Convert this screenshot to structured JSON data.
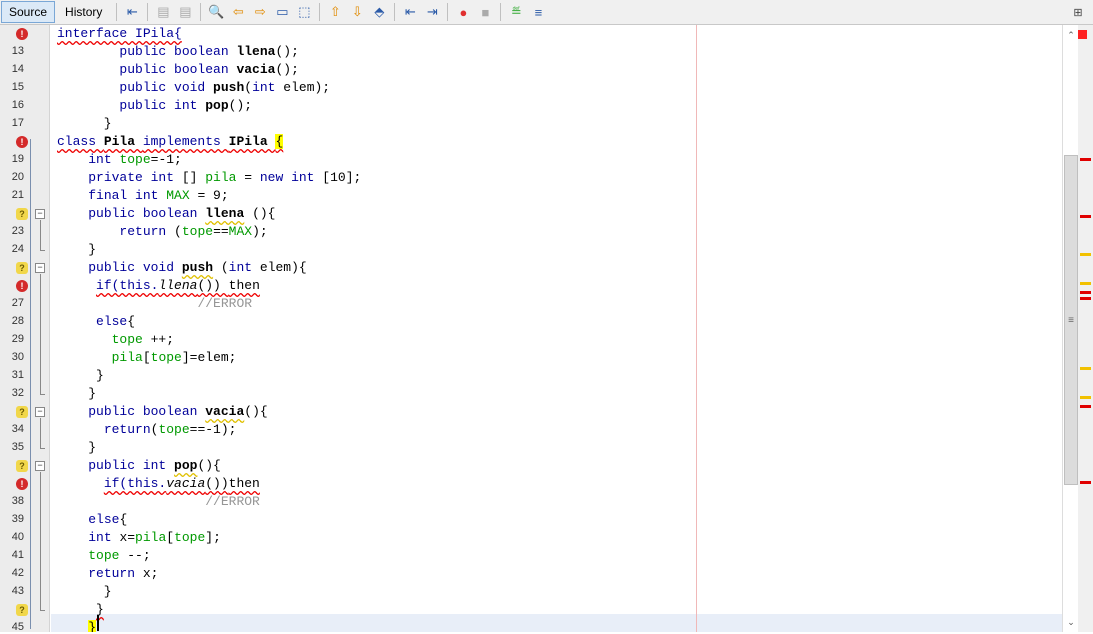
{
  "toolbar": {
    "tabs": [
      {
        "label": "Source",
        "active": true
      },
      {
        "label": "History",
        "active": false
      }
    ],
    "buttons": [
      "last-edit-icon",
      "back-icon",
      "forward-icon",
      "find-icon",
      "find-previous-icon",
      "find-next-icon",
      "toggle-highlight-icon",
      "rect-select-icon",
      "previous-bookmark-icon",
      "next-bookmark-icon",
      "toggle-bookmark-icon",
      "shift-left-icon",
      "shift-right-icon",
      "record-macro-icon",
      "stop-macro-icon",
      "comment-icon",
      "uncomment-icon"
    ]
  },
  "colors": {
    "error": "#e00000",
    "warning": "#f2c100",
    "keyword": "#000099",
    "field": "#009900",
    "comment": "#969696"
  },
  "lines": [
    {
      "n": "",
      "icon": "error",
      "t": [
        [
          "interface IPila{",
          "kw err"
        ]
      ]
    },
    {
      "n": "13",
      "t": [
        [
          "        ",
          ""
        ],
        [
          "public boolean ",
          "kw"
        ],
        [
          "llena",
          "mth"
        ],
        [
          "();",
          ""
        ]
      ]
    },
    {
      "n": "14",
      "t": [
        [
          "        ",
          ""
        ],
        [
          "public boolean ",
          "kw"
        ],
        [
          "vacia",
          "mth"
        ],
        [
          "();",
          ""
        ]
      ]
    },
    {
      "n": "15",
      "t": [
        [
          "        ",
          ""
        ],
        [
          "public void ",
          "kw"
        ],
        [
          "push",
          "mth"
        ],
        [
          "(",
          ""
        ],
        [
          "int ",
          "kw"
        ],
        [
          "elem);",
          ""
        ]
      ]
    },
    {
      "n": "16",
      "t": [
        [
          "        ",
          ""
        ],
        [
          "public int ",
          "kw"
        ],
        [
          "pop",
          "mth"
        ],
        [
          "();",
          ""
        ]
      ]
    },
    {
      "n": "17",
      "t": [
        [
          "      }",
          ""
        ]
      ]
    },
    {
      "n": "",
      "icon": "error",
      "t": [
        [
          "class ",
          "kw err"
        ],
        [
          "Pila ",
          "mth err"
        ],
        [
          "implements ",
          "kw err"
        ],
        [
          "IPila ",
          "mth err"
        ],
        [
          "{",
          "hl err"
        ]
      ]
    },
    {
      "n": "19",
      "t": [
        [
          "    ",
          ""
        ],
        [
          "int ",
          "kw"
        ],
        [
          "tope",
          "fld"
        ],
        [
          "=-1;",
          ""
        ]
      ]
    },
    {
      "n": "20",
      "t": [
        [
          "    ",
          ""
        ],
        [
          "private int ",
          "kw"
        ],
        [
          "[] ",
          ""
        ],
        [
          "pila",
          "fld"
        ],
        [
          " = ",
          ""
        ],
        [
          "new int ",
          "kw"
        ],
        [
          "[10];",
          ""
        ]
      ]
    },
    {
      "n": "21",
      "t": [
        [
          "    ",
          ""
        ],
        [
          "final int ",
          "kw"
        ],
        [
          "MAX",
          "fld"
        ],
        [
          " = 9;",
          ""
        ]
      ]
    },
    {
      "n": "",
      "icon": "warning",
      "fold": true,
      "t": [
        [
          "    ",
          ""
        ],
        [
          "public boolean ",
          "kw"
        ],
        [
          "llena",
          "mth wrn"
        ],
        [
          " (){",
          ""
        ]
      ]
    },
    {
      "n": "23",
      "t": [
        [
          "        ",
          ""
        ],
        [
          "return ",
          "kw"
        ],
        [
          "(",
          ""
        ],
        [
          "tope",
          "fld"
        ],
        [
          "==",
          ""
        ],
        [
          "MAX",
          "fld"
        ],
        [
          ");",
          ""
        ]
      ]
    },
    {
      "n": "24",
      "t": [
        [
          "    }",
          ""
        ]
      ]
    },
    {
      "n": "",
      "icon": "warning",
      "fold": true,
      "t": [
        [
          "    ",
          ""
        ],
        [
          "public void ",
          "kw"
        ],
        [
          "push",
          "mth wrn"
        ],
        [
          " (",
          ""
        ],
        [
          "int ",
          "kw"
        ],
        [
          "elem){",
          ""
        ]
      ]
    },
    {
      "n": "",
      "icon": "error",
      "t": [
        [
          "     ",
          ""
        ],
        [
          "if(this.",
          "kw err"
        ],
        [
          "llena",
          "it err"
        ],
        [
          "()) ",
          "err"
        ],
        [
          "then",
          "err"
        ]
      ]
    },
    {
      "n": "27",
      "t": [
        [
          "                  ",
          ""
        ],
        [
          "//ERROR",
          "cmt"
        ]
      ]
    },
    {
      "n": "28",
      "t": [
        [
          "     ",
          ""
        ],
        [
          "else",
          "kw"
        ],
        [
          "{",
          ""
        ]
      ]
    },
    {
      "n": "29",
      "t": [
        [
          "       ",
          ""
        ],
        [
          "tope",
          "fld"
        ],
        [
          " ++;",
          ""
        ]
      ]
    },
    {
      "n": "30",
      "t": [
        [
          "       ",
          ""
        ],
        [
          "pila",
          "fld"
        ],
        [
          "[",
          ""
        ],
        [
          "tope",
          "fld"
        ],
        [
          "]=elem;",
          ""
        ]
      ]
    },
    {
      "n": "31",
      "t": [
        [
          "     }",
          ""
        ]
      ]
    },
    {
      "n": "32",
      "t": [
        [
          "    }",
          ""
        ]
      ]
    },
    {
      "n": "",
      "icon": "warning",
      "fold": true,
      "t": [
        [
          "    ",
          ""
        ],
        [
          "public boolean ",
          "kw"
        ],
        [
          "vacia",
          "mth wrn"
        ],
        [
          "(){",
          ""
        ]
      ]
    },
    {
      "n": "34",
      "t": [
        [
          "      ",
          ""
        ],
        [
          "return",
          "kw"
        ],
        [
          "(",
          ""
        ],
        [
          "tope",
          "fld"
        ],
        [
          "==-1);",
          ""
        ]
      ]
    },
    {
      "n": "35",
      "t": [
        [
          "    }",
          ""
        ]
      ]
    },
    {
      "n": "",
      "icon": "warning",
      "fold": true,
      "t": [
        [
          "    ",
          ""
        ],
        [
          "public int ",
          "kw"
        ],
        [
          "pop",
          "mth wrn"
        ],
        [
          "(){",
          ""
        ]
      ]
    },
    {
      "n": "",
      "icon": "error",
      "t": [
        [
          "      ",
          ""
        ],
        [
          "if(this.",
          "kw err"
        ],
        [
          "vacia",
          "it err"
        ],
        [
          "())",
          "err"
        ],
        [
          "then",
          "err"
        ]
      ]
    },
    {
      "n": "38",
      "t": [
        [
          "                   ",
          ""
        ],
        [
          "//ERROR",
          "cmt"
        ]
      ]
    },
    {
      "n": "39",
      "t": [
        [
          "    ",
          ""
        ],
        [
          "else",
          "kw"
        ],
        [
          "{",
          ""
        ]
      ]
    },
    {
      "n": "40",
      "t": [
        [
          "    ",
          ""
        ],
        [
          "int ",
          "kw"
        ],
        [
          "x=",
          ""
        ],
        [
          "pila",
          "fld"
        ],
        [
          "[",
          ""
        ],
        [
          "tope",
          "fld"
        ],
        [
          "];",
          ""
        ]
      ]
    },
    {
      "n": "41",
      "t": [
        [
          "    ",
          ""
        ],
        [
          "tope",
          "fld"
        ],
        [
          " --;",
          ""
        ]
      ]
    },
    {
      "n": "42",
      "t": [
        [
          "    ",
          ""
        ],
        [
          "return ",
          "kw"
        ],
        [
          "x;",
          ""
        ]
      ]
    },
    {
      "n": "43",
      "t": [
        [
          "      }",
          ""
        ]
      ]
    },
    {
      "n": "",
      "icon": "warning-error",
      "t": [
        [
          "     ",
          ""
        ],
        [
          "}",
          "err"
        ]
      ]
    },
    {
      "n": "45",
      "t": [
        [
          "    ",
          ""
        ],
        [
          "}",
          "hl"
        ]
      ]
    }
  ],
  "stripe_marks": [
    {
      "kind": "error",
      "line": 19
    },
    {
      "kind": "error",
      "line": 22
    },
    {
      "kind": "warning",
      "line": 24
    },
    {
      "kind": "warning",
      "line": 25.5
    },
    {
      "kind": "error",
      "line": 26
    },
    {
      "kind": "error",
      "line": 26.3
    },
    {
      "kind": "warning",
      "line": 30
    },
    {
      "kind": "warning",
      "line": 31.5
    },
    {
      "kind": "error",
      "line": 32
    },
    {
      "kind": "error",
      "line": 36
    }
  ]
}
